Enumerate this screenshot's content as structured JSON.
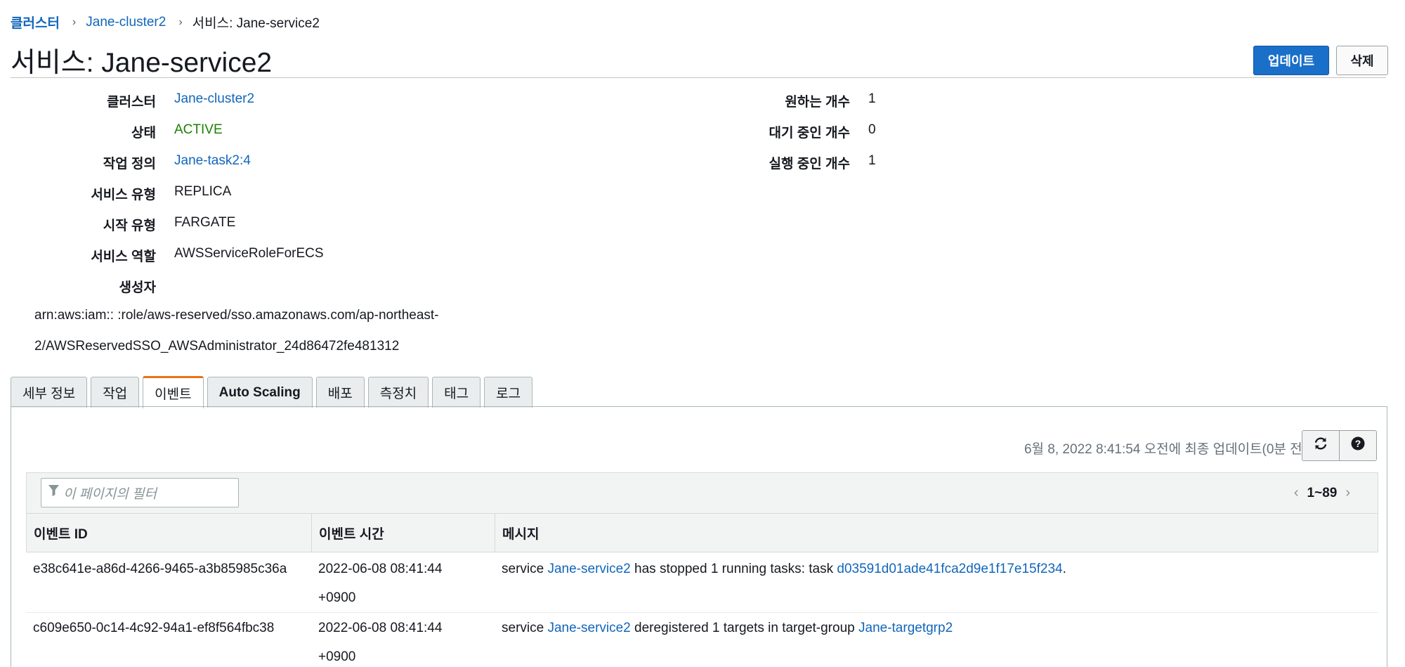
{
  "breadcrumb": {
    "root": "클러스터",
    "cluster": "Jane-cluster2",
    "current": "서비스: Jane-service2"
  },
  "title": "서비스: Jane-service2",
  "actions": {
    "update": "업데이트",
    "delete": "삭제"
  },
  "details_left": [
    {
      "label": "클러스터",
      "value": "Jane-cluster2"
    },
    {
      "label": "상태",
      "value": "ACTIVE"
    },
    {
      "label": "작업 정의",
      "value": "Jane-task2:4"
    },
    {
      "label": "서비스 유형",
      "value": "REPLICA"
    },
    {
      "label": "시작 유형",
      "value": "FARGATE"
    },
    {
      "label": "서비스 역할",
      "value": "AWSServiceRoleForECS"
    },
    {
      "label": "생성자",
      "value": ""
    }
  ],
  "created_by_arn": {
    "line1": "arn:aws:iam::          :role/aws-reserved/sso.amazonaws.com/ap-northeast-",
    "line2": "2/AWSReservedSSO_AWSAdministrator_24d86472fe481312"
  },
  "details_right": [
    {
      "label": "원하는 개수",
      "value": "1"
    },
    {
      "label": "대기 중인 개수",
      "value": "0"
    },
    {
      "label": "실행 중인 개수",
      "value": "1"
    }
  ],
  "tabs": [
    {
      "label": "세부 정보"
    },
    {
      "label": "작업"
    },
    {
      "label": "이벤트",
      "active": true
    },
    {
      "label": "Auto Scaling"
    },
    {
      "label": "배포"
    },
    {
      "label": "측정치"
    },
    {
      "label": "태그"
    },
    {
      "label": "로그"
    }
  ],
  "events": {
    "last_updated": "6월 8, 2022 8:41:54 오전에 최종 업데이트(0분 전)",
    "filter_placeholder": "이 페이지의 필터",
    "pager": "1~89",
    "columns": [
      "이벤트 ID",
      "이벤트 시간",
      "메시지"
    ],
    "rows": [
      {
        "id": "e38c641e-a86d-4266-9465-a3b85985c36a",
        "time_date": "2022-06-08 08:41:44",
        "time_tz": "+0900",
        "msg_pre": "service ",
        "msg_link1": "Jane-service2",
        "msg_mid": " has stopped 1 running tasks: task ",
        "msg_link2": "d03591d01ade41fca2d9e1f17e15f234",
        "msg_post": "."
      },
      {
        "id": "c609e650-0c14-4c92-94a1-ef8f564fbc38",
        "time_date": "2022-06-08 08:41:44",
        "time_tz": "+0900",
        "msg_pre": "service ",
        "msg_link1": "Jane-service2",
        "msg_mid": " deregistered 1 targets in target-group ",
        "msg_link2": "Jane-targetgrp2",
        "msg_post": ""
      }
    ]
  },
  "colors": {
    "link": "#1166bb",
    "active_status": "#1d8102",
    "primary_button": "#1a6fc9",
    "active_tab_accent": "#ec7211"
  },
  "icons": {
    "refresh": "refresh-icon",
    "help": "help-icon",
    "filter": "filter-icon",
    "breadcrumb_separator": "chevron-right-icon"
  }
}
